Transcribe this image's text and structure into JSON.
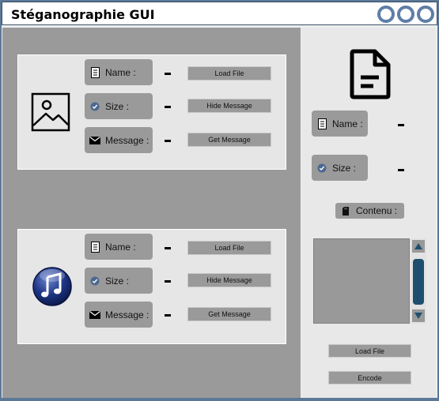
{
  "window": {
    "title": "Stéganographie GUI"
  },
  "image_panel": {
    "name_label": "Name :",
    "size_label": "Size :",
    "message_label": "Message :",
    "name_value": "-",
    "size_value": "-",
    "message_value": "-",
    "load_button": "Load File",
    "hide_button": "Hide Message",
    "get_button": "Get Message",
    "icon": "image-icon"
  },
  "audio_panel": {
    "name_label": "Name :",
    "size_label": "Size :",
    "message_label": "Message :",
    "name_value": "-",
    "size_value": "-",
    "message_value": "-",
    "load_button": "Load File",
    "hide_button": "Hide Message",
    "get_button": "Get Message",
    "icon": "music-note-icon"
  },
  "text_panel": {
    "icon": "document-icon",
    "name_label": "Name :",
    "size_label": "Size :",
    "name_value": "-",
    "size_value": "-",
    "content_label": "Contenu :",
    "content_value": "",
    "load_button": "Load File",
    "encode_button": "Encode"
  },
  "colors": {
    "window_frame": "#5b7897",
    "pane": "#9a9a9a",
    "scroll_thumb": "#1f4f6e",
    "control_icon": "#5d7ea7"
  }
}
